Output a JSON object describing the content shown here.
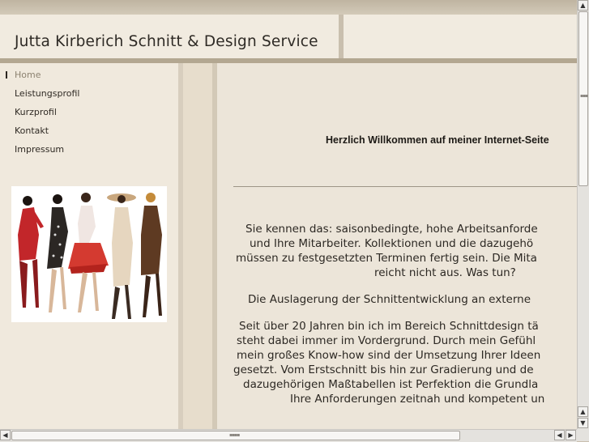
{
  "header": {
    "site_title": "Jutta Kirberich Schnitt & Design Service"
  },
  "sidebar": {
    "items": [
      {
        "label": "Home",
        "active": true
      },
      {
        "label": "Leistungsprofil",
        "active": false
      },
      {
        "label": "Kurzprofil",
        "active": false
      },
      {
        "label": "Kontakt",
        "active": false
      },
      {
        "label": "Impressum",
        "active": false
      }
    ]
  },
  "main": {
    "welcome": "Herzlich Willkommen auf meiner Internet-Seite",
    "paragraph1": [
      "Sie kennen das: saisonbedingte, hohe Arbeitsanforde",
      "und Ihre Mitarbeiter. Kollektionen und die dazugehö",
      "müssen zu festgesetzten Terminen fertig sein. Die Mita",
      "reicht nicht aus. Was tun?"
    ],
    "paragraph2": "Die Auslagerung der Schnittentwicklung an externe",
    "paragraph3": [
      "Seit über 20 Jahren bin ich im Bereich Schnittdesign tä",
      "steht dabei immer im Vordergrund. Durch mein Gefühl",
      "mein großes Know-how sind der Umsetzung Ihrer Ideen",
      "gesetzt. Vom Erstschnitt bis hin zur Gradierung und de",
      "dazugehörigen Maßtabellen ist Perfektion die Grundla",
      "Ihre Anforderungen zeitnah und kompetent un"
    ]
  },
  "scrollbars": {
    "up_arrow": "▲",
    "down_arrow": "▼",
    "left_arrow": "◀",
    "right_arrow": "▶"
  },
  "colors": {
    "background": "#c9bfae",
    "panel": "#f1ebe0",
    "content": "#ece5d9",
    "text": "#2c2823"
  }
}
